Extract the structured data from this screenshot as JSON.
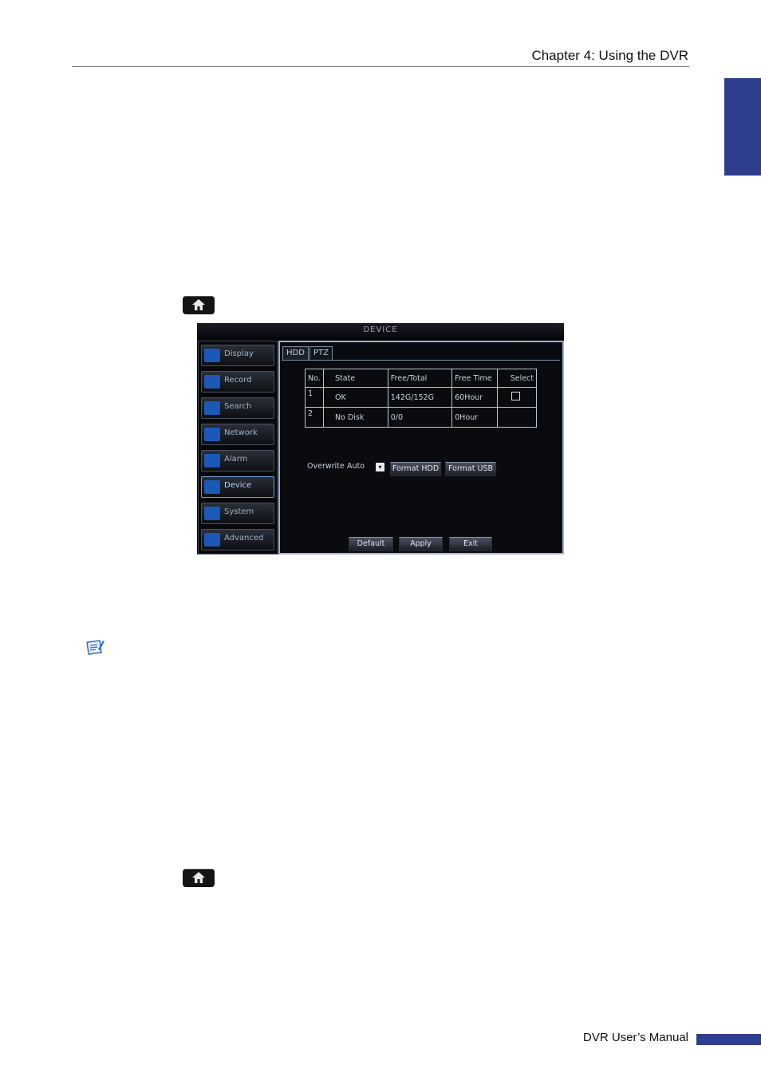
{
  "header": {
    "chapter_title": "Chapter 4: Using the DVR"
  },
  "dvr_screen": {
    "window_title": "DEVICE",
    "menu": [
      {
        "label": "Display",
        "icon": "monitor-icon"
      },
      {
        "label": "Record",
        "icon": "record-icon"
      },
      {
        "label": "Search",
        "icon": "search-icon"
      },
      {
        "label": "Network",
        "icon": "network-icon"
      },
      {
        "label": "Alarm",
        "icon": "alarm-icon"
      },
      {
        "label": "Device",
        "icon": "device-icon",
        "active": true
      },
      {
        "label": "System",
        "icon": "gear-icon"
      },
      {
        "label": "Advanced",
        "icon": "wrench-icon"
      }
    ],
    "tabs": [
      "HDD",
      "PTZ"
    ],
    "table": {
      "headers": [
        "No.",
        "State",
        "Free/Total",
        "Free Time",
        "Select"
      ],
      "rows": [
        [
          "1",
          "OK",
          "142G/152G",
          "60Hour",
          ""
        ],
        [
          "2",
          "No Disk",
          "0/0",
          "0Hour",
          ""
        ]
      ]
    },
    "overwrite_label": "Overwrite",
    "overwrite_value": "Auto",
    "format_hdd_label": "Format HDD",
    "format_usb_label": "Format USB",
    "default_label": "Default",
    "apply_label": "Apply",
    "exit_label": "Exit"
  },
  "footer": {
    "manual_title": "DVR User’s Manual"
  },
  "colors": {
    "accent_blue": "#2e3d8e"
  }
}
